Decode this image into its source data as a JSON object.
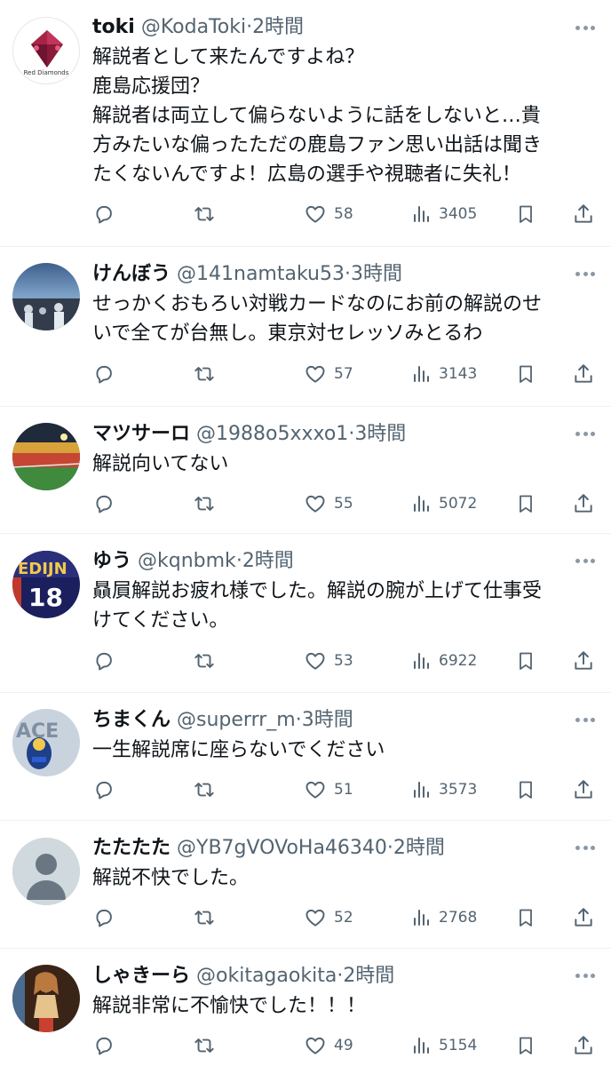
{
  "tweets": [
    {
      "name": "toki",
      "handle": "@KodaToki",
      "sep": "·",
      "time": "2時間",
      "lines": [
        "解説者として来たんですよね？",
        "鹿島応援団？",
        "解説者は両立して偏らないように話をしないと…貴",
        "方みたいな偏ったただの鹿島ファン思い出話は聞き",
        "たくないんですよ！広島の選手や視聴者に失礼！"
      ],
      "likes": "58",
      "views": "3405",
      "avatar_label": "Red Diamonds"
    },
    {
      "name": "けんぼう",
      "handle": "@141namtaku53",
      "sep": "·",
      "time": "3時間",
      "lines": [
        "せっかくおもろい対戦カードなのにお前の解説のせ",
        "いで全てが台無し。東京対セレッソみとるわ"
      ],
      "likes": "57",
      "views": "3143"
    },
    {
      "name": "マツサーロ",
      "handle": "@1988o5xxxo1",
      "sep": "·",
      "time": "3時間",
      "lines": [
        "解説向いてない"
      ],
      "likes": "55",
      "views": "5072"
    },
    {
      "name": "ゆう",
      "handle": "@kqnbmk",
      "sep": "·",
      "time": "2時間",
      "lines": [
        "贔屓解説お疲れ様でした。解説の腕が上げて仕事受",
        "けてください。"
      ],
      "likes": "53",
      "views": "6922",
      "avatar_text": [
        "EDIJN",
        "18"
      ]
    },
    {
      "name": "ちまくん",
      "handle": "@superrr_m",
      "sep": "·",
      "time": "3時間",
      "lines": [
        "一生解説席に座らないでください"
      ],
      "likes": "51",
      "views": "3573",
      "avatar_text": [
        "ACE"
      ]
    },
    {
      "name": "たたたた",
      "handle": "@YB7gVOVoHa46340",
      "sep": "·",
      "time": "2時間",
      "lines": [
        "解説不快でした。"
      ],
      "likes": "52",
      "views": "2768"
    },
    {
      "name": "しゃきーら",
      "handle": "@okitagaokita",
      "sep": "·",
      "time": "2時間",
      "lines": [
        "解説非常に不愉快でした！！！"
      ],
      "likes": "49",
      "views": "5154"
    }
  ],
  "colors": {
    "text": "#0f1419",
    "muted": "#536471",
    "divider": "#eff3f4"
  },
  "icons": [
    "reply-icon",
    "retweet-icon",
    "heart-icon",
    "views-icon",
    "bookmark-icon",
    "share-icon",
    "more-icon"
  ]
}
